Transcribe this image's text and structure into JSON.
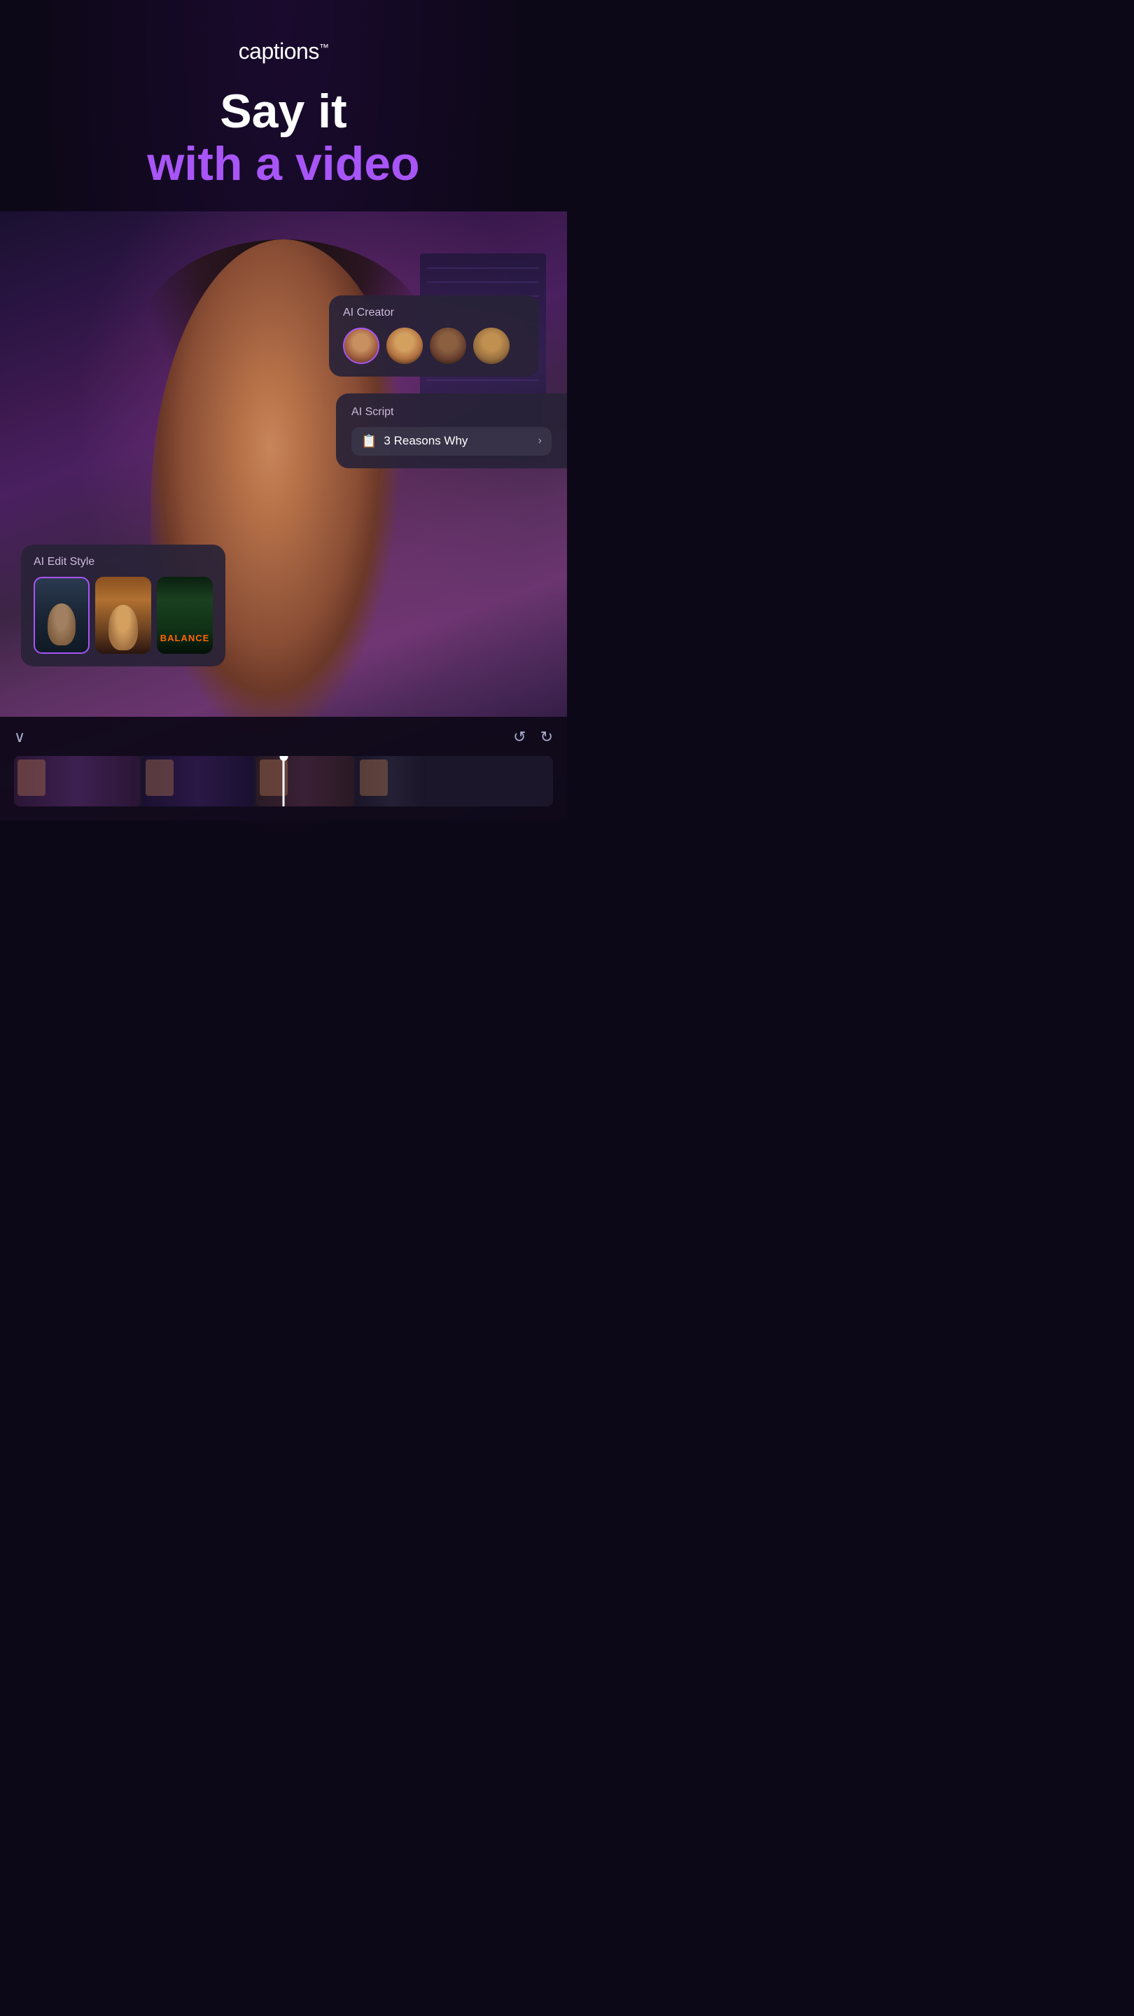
{
  "app": {
    "logo": "captions",
    "logo_tm": "™"
  },
  "hero": {
    "line1": "Say it",
    "line2": "with a video"
  },
  "ai_creator": {
    "label": "AI Creator",
    "avatars": [
      {
        "id": 1,
        "selected": true,
        "label": "Avatar 1"
      },
      {
        "id": 2,
        "selected": false,
        "label": "Avatar 2"
      },
      {
        "id": 3,
        "selected": false,
        "label": "Avatar 3"
      },
      {
        "id": 4,
        "selected": false,
        "label": "Avatar 4"
      }
    ]
  },
  "ai_script": {
    "label": "AI Script",
    "selected_value": "3 Reasons Why",
    "icon": "📋"
  },
  "ai_edit_style": {
    "label": "AI Edit Style",
    "styles": [
      {
        "id": 1,
        "selected": true,
        "label": "Style 1"
      },
      {
        "id": 2,
        "selected": false,
        "label": "Style 2"
      },
      {
        "id": 3,
        "selected": false,
        "label": "BALANCE"
      }
    ]
  },
  "controls": {
    "chevron_down": "∨",
    "undo": "↺",
    "redo": "↻"
  }
}
